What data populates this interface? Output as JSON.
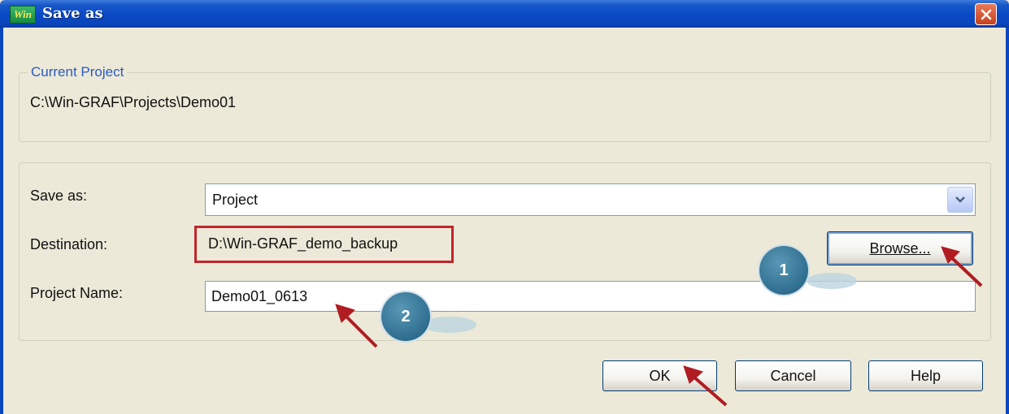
{
  "window": {
    "title": "Save as",
    "icon_text": "Win"
  },
  "current_project": {
    "group_title": "Current Project",
    "path": "C:\\Win-GRAF\\Projects\\Demo01"
  },
  "form": {
    "save_as_label": "Save as:",
    "save_as_value": "Project",
    "destination_label": "Destination:",
    "destination_value": "D:\\Win-GRAF_demo_backup",
    "browse_label": "Browse...",
    "project_name_label": "Project Name:",
    "project_name_value": "Demo01_0613"
  },
  "buttons": {
    "ok": "OK",
    "cancel": "Cancel",
    "help": "Help"
  },
  "annotations": {
    "step1": "1",
    "step2": "2",
    "highlight_color": "#c0252b",
    "arrow_color": "#b01c22"
  },
  "icons": {
    "close": "close-icon",
    "dropdown": "chevron-down-icon",
    "app": "app-icon"
  }
}
